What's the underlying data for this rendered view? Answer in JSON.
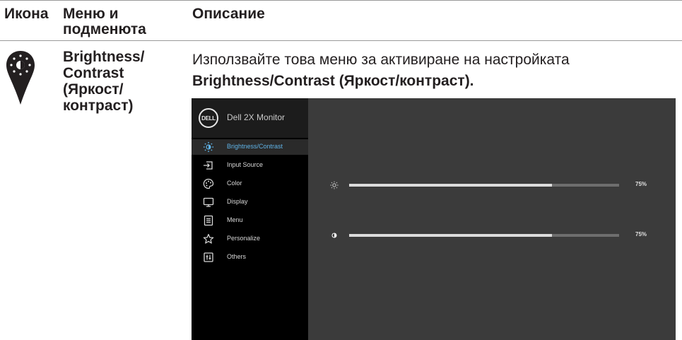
{
  "header": {
    "col_icon": "Икона",
    "col_menu": "Меню и подменюта",
    "col_desc": "Описание"
  },
  "row": {
    "icon": "brightness-pin-icon",
    "menu_name": "Brightness/ Contrast (Яркост/ контраст)",
    "desc_text": "Използвайте това меню за активиране на настройката",
    "desc_bold": "Brightness/Contrast (Яркост/контраст)."
  },
  "osd": {
    "logo": "DELL",
    "title": "Dell 2X Monitor",
    "menu": [
      {
        "label": "Brightness/Contrast",
        "icon": "brightness-icon",
        "selected": true
      },
      {
        "label": "Input Source",
        "icon": "input-source-icon",
        "selected": false
      },
      {
        "label": "Color",
        "icon": "color-palette-icon",
        "selected": false
      },
      {
        "label": "Display",
        "icon": "display-monitor-icon",
        "selected": false
      },
      {
        "label": "Menu",
        "icon": "menu-list-icon",
        "selected": false
      },
      {
        "label": "Personalize",
        "icon": "star-icon",
        "selected": false
      },
      {
        "label": "Others",
        "icon": "others-icon",
        "selected": false
      }
    ],
    "brightness": {
      "value": 0.75,
      "label": "75%"
    },
    "contrast": {
      "value": 0.75,
      "label": "75%"
    },
    "colors": {
      "background": "#3b3b3b",
      "sidebar": "#000000",
      "accent": "#5fb2e6"
    }
  }
}
